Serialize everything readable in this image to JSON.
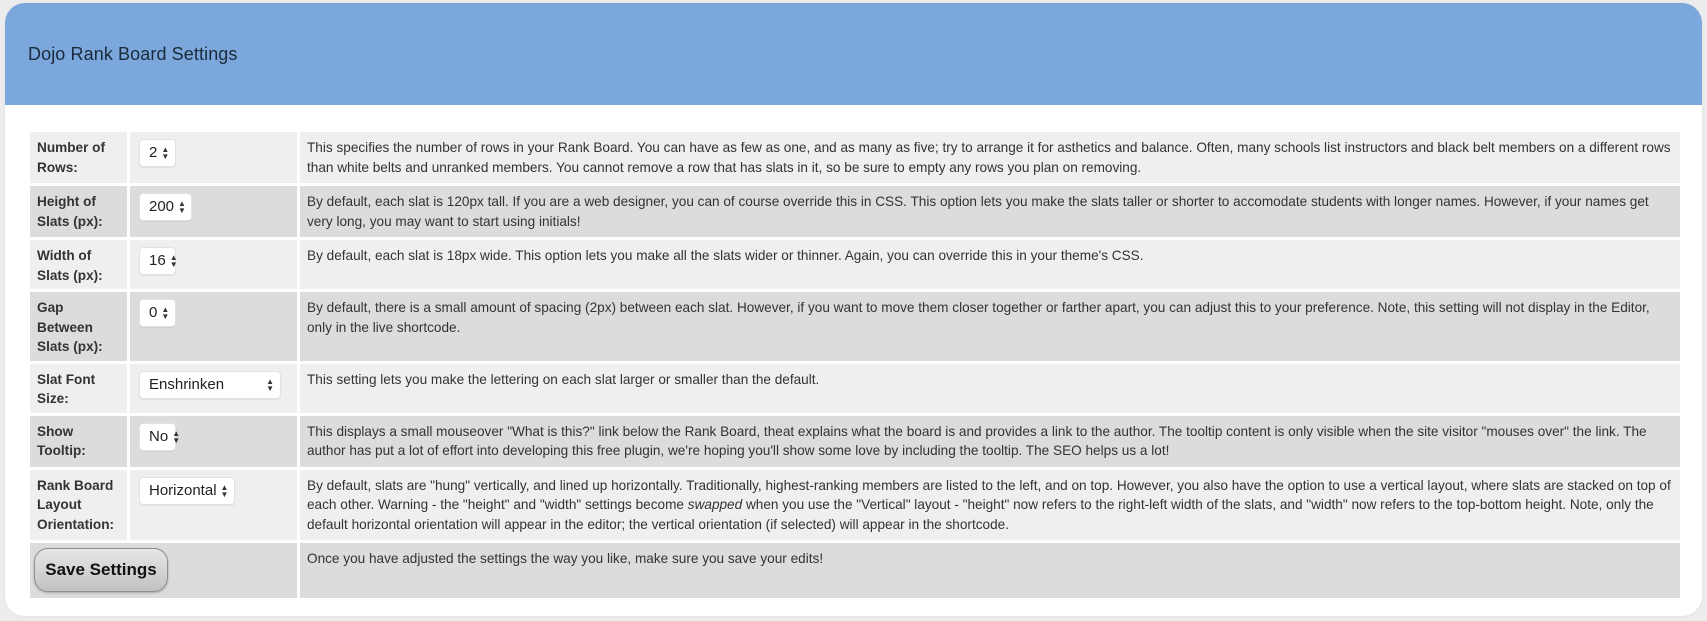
{
  "header": {
    "title": "Dojo Rank Board Settings"
  },
  "rows": [
    {
      "label": "Number of Rows:",
      "value": "2",
      "description": "This specifies the number of rows in your Rank Board. You can have as few as one, and as many as five; try to arrange it for asthetics and balance. Often, many schools list instructors and black belt members on a different rows than white belts and unranked members. You cannot remove a row that has slats in it, so be sure to empty any rows you plan on removing."
    },
    {
      "label": "Height of Slats (px):",
      "value": "200",
      "description": "By default, each slat is 120px tall. If you are a web designer, you can of course override this in CSS. This option lets you make the slats taller or shorter to accomodate students with longer names. However, if your names get very long, you may want to start using initials!"
    },
    {
      "label": "Width of Slats (px):",
      "value": "16",
      "description": "By default, each slat is 18px wide. This option lets you make all the slats wider or thinner. Again, you can override this in your theme's CSS."
    },
    {
      "label": "Gap Between Slats (px):",
      "value": "0",
      "description": "By default, there is a small amount of spacing (2px) between each slat. However, if you want to move them closer together or farther apart, you can adjust this to your preference. Note, this setting will not display in the Editor, only in the live shortcode."
    },
    {
      "label": "Slat Font Size:",
      "value": "Enshrinken",
      "description": "This setting lets you make the lettering on each slat larger or smaller than the default."
    },
    {
      "label": "Show Tooltip:",
      "value": "No",
      "description": "This displays a small mouseover \"What is this?\" link below the Rank Board, theat explains what the board is and provides a link to the author. The tooltip content is only visible when the site visitor \"mouses over\" the link. The author has put a lot of effort into developing this free plugin, we're hoping you'll show some love by including the tooltip. The SEO helps us a lot!"
    },
    {
      "label": "Rank Board Layout Orientation:",
      "value": "Horizontal",
      "description_before": "By default, slats are \"hung\" vertically, and lined up horizontally. Traditionally, highest-ranking members are listed to the left, and on top. However, you also have the option to use a vertical layout, where slats are stacked on top of each other. Warning - the \"height\" and \"width\" settings become ",
      "description_emph": "swapped",
      "description_after": " when you use the \"Vertical\" layout - \"height\" now refers to the right-left width of the slats, and \"width\" now refers to the top-bottom height. Note, only the default horizontal orientation will appear in the editor; the vertical orientation (if selected) will appear in the shortcode."
    }
  ],
  "save": {
    "label": "Save Settings",
    "description": "Once you have adjusted the settings the way you like, make sure you save your edits!"
  }
}
